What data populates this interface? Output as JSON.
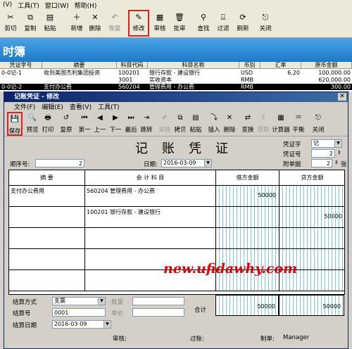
{
  "outer": {
    "menu": [
      "(V)",
      "工具(T)",
      "窗口(W)",
      "帮助(H)"
    ],
    "toolbar": [
      {
        "label": "剪切",
        "icon": "✂",
        "disabled": false
      },
      {
        "label": "复制",
        "icon": "⧉",
        "disabled": false
      },
      {
        "label": "粘贴",
        "icon": "▤",
        "disabled": false
      },
      {
        "label": "新增",
        "icon": "＋",
        "disabled": false
      },
      {
        "label": "删除",
        "icon": "✕",
        "disabled": false
      },
      {
        "label": "恢复",
        "icon": "↶",
        "disabled": true
      },
      {
        "label": "修改",
        "icon": "✎",
        "disabled": false
      },
      {
        "label": "审核",
        "icon": "▦",
        "disabled": false
      },
      {
        "label": "批审",
        "icon": "🗑",
        "disabled": false
      },
      {
        "label": "查找",
        "icon": "⚲",
        "disabled": false
      },
      {
        "label": "过滤",
        "icon": "⌸",
        "disabled": false
      },
      {
        "label": "刷新",
        "icon": "⟳",
        "disabled": false
      },
      {
        "label": "关闭",
        "icon": "⎋",
        "disabled": false
      }
    ],
    "banner": "时簿",
    "grid": {
      "headers": [
        "凭证字号",
        "摘要",
        "科目代码",
        "科目名称",
        "币别",
        "汇率",
        "原币金额"
      ],
      "rows": [
        {
          "voucher": "0-0记-1",
          "summary": "收到美国杰利集团投资",
          "code": "100201",
          "name": "银行存款 - 建设银行",
          "currency": "USD",
          "rate": "6.20",
          "amount": "100,000.00"
        },
        {
          "voucher": "",
          "summary": "",
          "code": "3001",
          "name": "实收资本",
          "currency": "RMB",
          "rate": "",
          "amount": "620,000.00"
        },
        {
          "voucher": "0-0记-2",
          "summary": "支付办公费",
          "code": "560204",
          "name": "管理费用 - 办公费",
          "currency": "RMB",
          "rate": "",
          "amount": "300.00"
        }
      ]
    }
  },
  "dialog": {
    "title": "记账凭证 - 修改",
    "close": "✕",
    "menu": [
      "文件(F)",
      "编辑(E)",
      "查看(V)",
      "工具(T)"
    ],
    "toolbar": [
      {
        "label": "保存",
        "icon": "💾",
        "disabled": false
      },
      {
        "label": "预览",
        "icon": "🔍",
        "disabled": false
      },
      {
        "label": "打印",
        "icon": "🖶",
        "disabled": false
      },
      {
        "label": "复原",
        "icon": "↺",
        "disabled": false
      },
      {
        "label": "第一",
        "icon": "⏮",
        "disabled": false
      },
      {
        "label": "上一",
        "icon": "◀",
        "disabled": false
      },
      {
        "label": "下一",
        "icon": "▶",
        "disabled": false
      },
      {
        "label": "最后",
        "icon": "⏭",
        "disabled": false
      },
      {
        "label": "跳转",
        "icon": "⇥",
        "disabled": false
      },
      {
        "label": "审核",
        "icon": "✔",
        "disabled": true
      },
      {
        "label": "拷贝",
        "icon": "⧉",
        "disabled": false
      },
      {
        "label": "粘贴",
        "icon": "▤",
        "disabled": false
      },
      {
        "label": "插入",
        "icon": "⤵",
        "disabled": false
      },
      {
        "label": "删除",
        "icon": "✕",
        "disabled": false
      },
      {
        "label": "变换",
        "icon": "⇄",
        "disabled": false
      },
      {
        "label": "获取",
        "icon": "⇩",
        "disabled": true
      },
      {
        "label": "计算器",
        "icon": "▦",
        "disabled": false
      },
      {
        "label": "平衡",
        "icon": "＝",
        "disabled": false
      },
      {
        "label": "关闭",
        "icon": "⎋",
        "disabled": false
      }
    ],
    "doc_title": "记账凭证",
    "voucher_word_label": "凭证字",
    "voucher_word": "记",
    "voucher_no_label": "凭证号",
    "voucher_no": "2",
    "attachments_label": "附单据",
    "attachments": "2",
    "attachments_unit": "张",
    "seq_label": "顺序号:",
    "seq": "2",
    "date_label": "日期:",
    "date": "2016-03-09",
    "col_summary": "摘 要",
    "col_account": "会 计 科 目",
    "col_debit": "借方金额",
    "col_credit": "贷方金额",
    "lines": [
      {
        "summary": "支付办公费用",
        "account": "560204 管理费用 - 办公费",
        "debit": "50000",
        "credit": ""
      },
      {
        "summary": "",
        "account": "100201 银行存款 - 建设银行",
        "debit": "",
        "credit": "50000"
      },
      {
        "summary": "",
        "account": "",
        "debit": "",
        "credit": ""
      },
      {
        "summary": "",
        "account": "",
        "debit": "",
        "credit": ""
      },
      {
        "summary": "",
        "account": "",
        "debit": "",
        "credit": ""
      }
    ],
    "settle_method_label": "结算方式",
    "settle_method": "支票",
    "qty_label": "数量",
    "settle_no_label": "结算号",
    "settle_no": "0001",
    "price_label": "单价",
    "settle_date_label": "结算日期",
    "settle_date": "2016-03-09",
    "total_label": "合计",
    "total_debit": "50000",
    "total_credit": "50000",
    "auditor_label": "审核:",
    "poster_label": "过账:",
    "maker_label": "制单:",
    "maker": "Manager",
    "watermark": "new.ufidawhy.com"
  }
}
